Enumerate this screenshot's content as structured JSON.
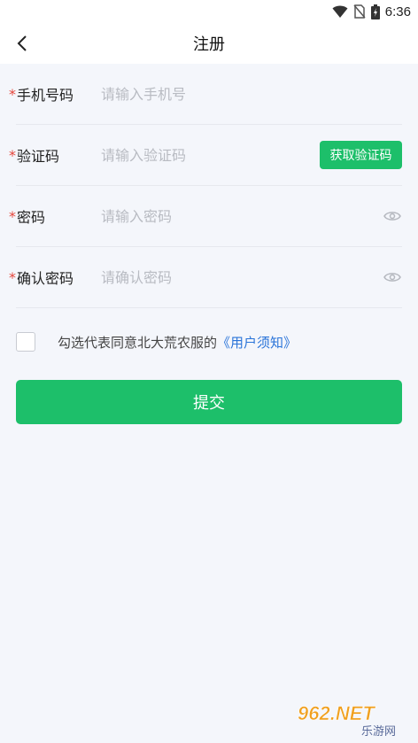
{
  "status_bar": {
    "time": "6:36"
  },
  "nav": {
    "title": "注册"
  },
  "form": {
    "phone": {
      "label": "手机号码",
      "placeholder": "请输入手机号"
    },
    "code": {
      "label": "验证码",
      "placeholder": "请输入验证码",
      "button": "获取验证码"
    },
    "password": {
      "label": "密码",
      "placeholder": "请输入密码"
    },
    "confirm": {
      "label": "确认密码",
      "placeholder": "请确认密码"
    },
    "required_mark": "*"
  },
  "agreement": {
    "text": "勾选代表同意北大荒农服的",
    "link": "《用户须知》"
  },
  "submit": {
    "label": "提交"
  },
  "watermark": {
    "brand": "962.NET",
    "sub": "乐游网"
  },
  "colors": {
    "accent": "#1dbf6a",
    "link": "#2a74d9",
    "required": "#e5463b",
    "background": "#f4f6fb"
  }
}
